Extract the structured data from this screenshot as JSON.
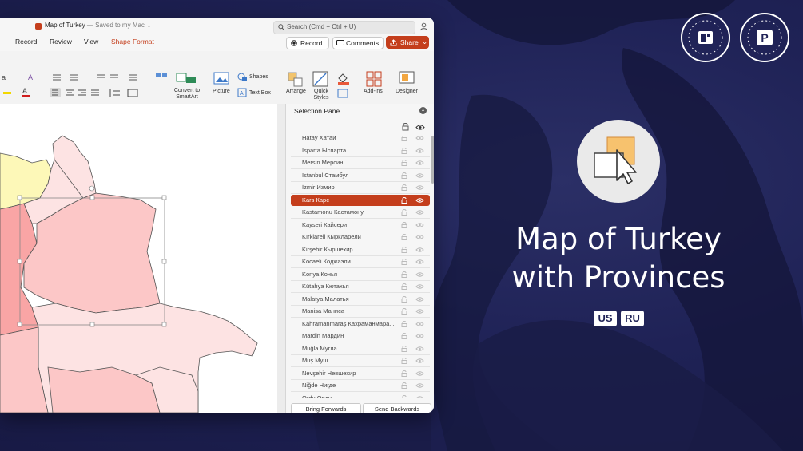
{
  "window": {
    "doc_title": "Map of Turkey",
    "doc_status": " — Saved to my Mac",
    "search_placeholder": "Search (Cmd + Ctrl + U)"
  },
  "tabs": [
    "Record",
    "Review",
    "View",
    "Shape Format"
  ],
  "active_tab": "Shape Format",
  "toolbar": {
    "record_label": "Record",
    "comments_label": "Comments",
    "share_label": "Share"
  },
  "ribbon": {
    "convert_label": "Convert to\nSmartArt",
    "picture_label": "Picture",
    "shapes_label": "Shapes",
    "textbox_label": "Text Box",
    "arrange_label": "Arrange",
    "quick_styles_label": "Quick\nStyles",
    "addins_label": "Add-ins",
    "designer_label": "Designer"
  },
  "selection_pane": {
    "title": "Selection Pane",
    "items": [
      "Hatay Хатай",
      "Isparta Ыспарта",
      "Mersin Мерсин",
      "Istanbul Стамбул",
      "İzmir Измир",
      "Kars Карс",
      "Kastamonu Кастамону",
      "Kayseri Кайсери",
      "Kırklareli Кыркларели",
      "Kirşehir Кыршехир",
      "Kocaeli Коджаэли",
      "Konya Конья",
      "Kütahya Кютахья",
      "Malatya Малатья",
      "Manisa Маниса",
      "Kahramanmaraş Кахраманмара...",
      "Mardin Мардин",
      "Muğla Мугла",
      "Muş Муш",
      "Nevşehir Невшехир",
      "Niğde Нигде",
      "Ordu Орду"
    ],
    "selected_item": "Kars Карс",
    "bring_forwards": "Bring Forwards",
    "send_backwards": "Send Backwards"
  },
  "hero": {
    "title_line1": "Map of Turkey",
    "title_line2": "with Provinces",
    "lang_us": "US",
    "lang_ru": "RU"
  },
  "colors": {
    "accent": "#c43e1c",
    "background": "#1f2256",
    "map_pink_light": "#fde3e3",
    "map_pink_mid": "#fcc7c7",
    "map_pink_dark": "#f9a5a5",
    "map_yellow": "#fdf8b8"
  }
}
